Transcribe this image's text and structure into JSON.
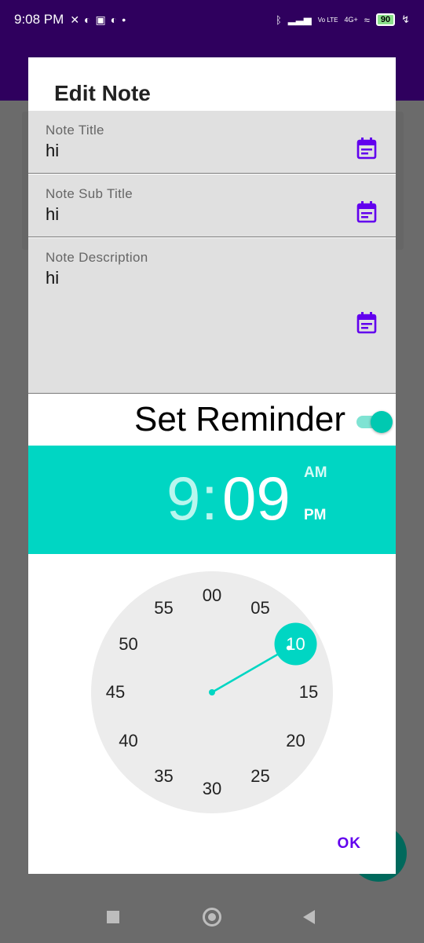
{
  "status_bar": {
    "time": "9:08 PM",
    "network_label": "4G+",
    "volte_label": "Vo LTE",
    "battery": "90"
  },
  "dialog": {
    "title": "Edit Note",
    "fields": [
      {
        "label": "Note Title",
        "value": "hi"
      },
      {
        "label": "Note Sub Title",
        "value": "hi"
      },
      {
        "label": "Note Description",
        "value": "hi"
      }
    ],
    "reminder": {
      "label": "Set Reminder",
      "enabled": true
    },
    "time_picker": {
      "hour": "9",
      "colon": ":",
      "minute": "09",
      "am": "AM",
      "pm": "PM",
      "selected_period": "PM",
      "selected_minute": "10",
      "minute_labels": [
        "00",
        "05",
        "10",
        "15",
        "20",
        "25",
        "30",
        "35",
        "40",
        "45",
        "50",
        "55"
      ]
    },
    "ok_label": "OK"
  },
  "colors": {
    "accent": "#00d6c3",
    "primary_purple": "#6200ee",
    "app_bar": "#2f005e"
  }
}
